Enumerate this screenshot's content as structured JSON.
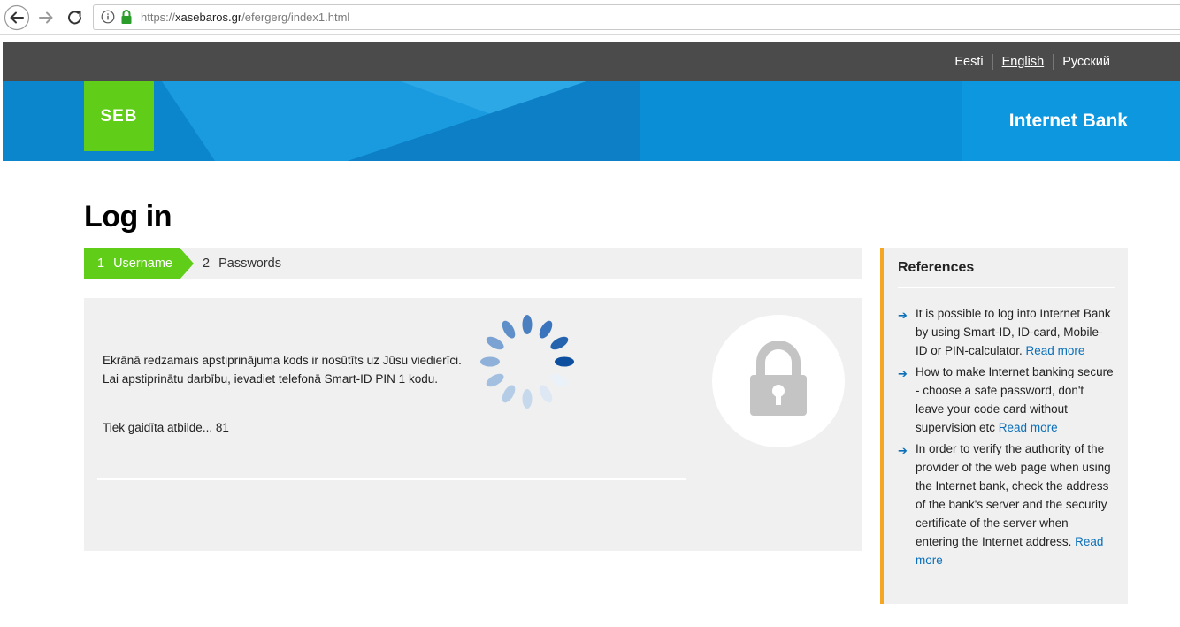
{
  "browser": {
    "url_scheme": "https://",
    "url_host": "xasebaros.gr",
    "url_path": "/efergerg/index1.html"
  },
  "languages": [
    {
      "label": "Eesti",
      "active": false
    },
    {
      "label": "English",
      "active": true
    },
    {
      "label": "Русский",
      "active": false
    }
  ],
  "banner": {
    "logo_text": "SEB",
    "title": "Internet Bank",
    "logo_color": "#60cd18",
    "brand_blue": "#0c8fd6"
  },
  "page": {
    "title": "Log in",
    "steps": [
      {
        "num": "1",
        "label": "Username",
        "active": true
      },
      {
        "num": "2",
        "label": "Passwords",
        "active": false
      }
    ],
    "message_line1": "Ekrānā redzamais apstiprinājuma kods ir nosūtīts uz Jūsu viedierīci.",
    "message_line2": "Lai apstiprinātu darbību, ievadiet telefonā Smart-ID PIN 1 kodu.",
    "wait_text": "Tiek gaidīta atbilde... 81",
    "lock_icon": "padlock-icon",
    "spinner_icon": "loading-spinner"
  },
  "references": {
    "title": "References",
    "items": [
      {
        "text": "It is possible to log into Internet Bank by using Smart-ID, ID-card, Mobile-ID or PIN-calculator. ",
        "link": "Read more"
      },
      {
        "text": "How to make Internet banking secure - choose a safe password, don't leave your code card without supervision etc ",
        "link": "Read more"
      },
      {
        "text": "In order to verify the authority of the provider of the web page when using the Internet bank, check the address of the bank's server and the security certificate of the server when entering the Internet address. ",
        "link": "Read more"
      }
    ]
  }
}
